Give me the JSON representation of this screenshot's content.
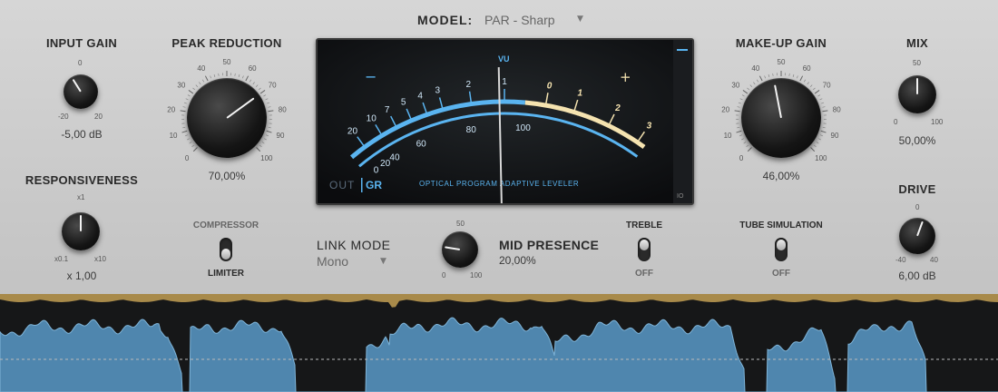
{
  "model": {
    "label": "MODEL:",
    "value": "PAR - Sharp",
    "arrow": "▼"
  },
  "input_gain": {
    "label": "INPUT GAIN",
    "value": "-5,00 dB",
    "scale": [
      "0",
      "-20",
      "20"
    ],
    "fraction": 0.38
  },
  "peak_reduction": {
    "label": "PEAK REDUCTION",
    "value": "70,00%",
    "scale": [
      "0",
      "10",
      "20",
      "30",
      "40",
      "50",
      "60",
      "70",
      "80",
      "90",
      "100"
    ],
    "fraction": 0.7
  },
  "responsiveness": {
    "label": "RESPONSIVENESS",
    "value": "x 1,00",
    "scale": [
      "x1",
      "x0.1",
      "x10"
    ],
    "fraction": 0.5
  },
  "compressor_limiter": {
    "top": "COMPRESSOR",
    "bottom": "LIMITER",
    "state": "LIMITER"
  },
  "vu": {
    "title": "VU",
    "minus": "−",
    "plus": "+",
    "upper_scale": [
      "20",
      "10",
      "7",
      "5",
      "4",
      "3",
      "2",
      "1",
      "0",
      "1",
      "2",
      "3"
    ],
    "lower_scale": [
      "0",
      "20",
      "40",
      "60",
      "80",
      "100"
    ],
    "out_label": "OUT",
    "gr_label": "GR",
    "caption": "OPTICAL PROGRAM ADAPTIVE LEVELER",
    "badge": "IO",
    "needle_fraction": 0.51
  },
  "link_mode": {
    "label": "LINK MODE",
    "value": "Mono",
    "arrow": "▼"
  },
  "mid_presence": {
    "label": "MID PRESENCE",
    "value": "20,00%",
    "scale": [
      "50",
      "0",
      "100"
    ],
    "fraction": 0.2
  },
  "treble": {
    "label": "TREBLE",
    "state": "OFF"
  },
  "makeup_gain": {
    "label": "MAKE-UP GAIN",
    "value": "46,00%",
    "scale": [
      "0",
      "10",
      "20",
      "30",
      "40",
      "50",
      "60",
      "70",
      "80",
      "90",
      "100"
    ],
    "fraction": 0.46
  },
  "tube_simulation": {
    "label": "TUBE SIMULATION",
    "state": "OFF"
  },
  "mix": {
    "label": "MIX",
    "value": "50,00%",
    "scale": [
      "50",
      "0",
      "100"
    ],
    "fraction": 0.5
  },
  "drive": {
    "label": "DRIVE",
    "value": "6,00 dB",
    "scale": [
      "0",
      "-40",
      "40"
    ],
    "fraction": 0.575
  },
  "colors": {
    "panel": "#cccccc",
    "vu_blue": "#5ab4f0",
    "vu_cream": "#f5e3b0",
    "wave": "#4f86ae",
    "wave_top": "#a88a4a"
  }
}
